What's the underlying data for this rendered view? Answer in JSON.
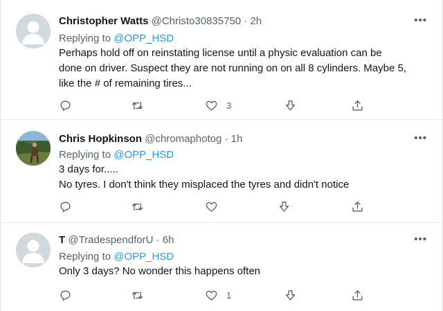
{
  "tweets": [
    {
      "name": "Christopher Watts",
      "handle": "@Christo30835750",
      "sep": "·",
      "time": "2h",
      "replying_prefix": "Replying to",
      "replying_handle": "@OPP_HSD",
      "text_lines": [
        "Perhaps hold off on reinstating license until a physic  evaluation can be",
        "done on driver. Suspect they are not running on on all 8 cylinders. Maybe 5,",
        "like the # of remaining tires..."
      ],
      "like_count": "3",
      "avatar": "default-avatar"
    },
    {
      "name": "Chris Hopkinson",
      "handle": "@chromaphotog",
      "sep": "·",
      "time": "1h",
      "replying_prefix": "Replying to",
      "replying_handle": "@OPP_HSD",
      "text_lines": [
        "3 days for.....",
        "No tyres. I don't think they misplaced the tyres and didn't notice"
      ],
      "like_count": "",
      "avatar": "photo-avatar"
    },
    {
      "name": "T",
      "handle": "@TradespendforU",
      "sep": "·",
      "time": "6h",
      "replying_prefix": "Replying to",
      "replying_handle": "@OPP_HSD",
      "text_lines": [
        "Only 3 days?  No wonder this happens often"
      ],
      "like_count": "1",
      "avatar": "default-avatar"
    }
  ],
  "more_label": "•••",
  "icons": [
    "reply-icon",
    "retweet-icon",
    "like-icon",
    "downvote-icon",
    "share-icon"
  ],
  "colors": {
    "link": "#1d9bf0",
    "secondary": "#536471",
    "text": "#0f1419",
    "avatar_bg": "#cfd9de"
  }
}
